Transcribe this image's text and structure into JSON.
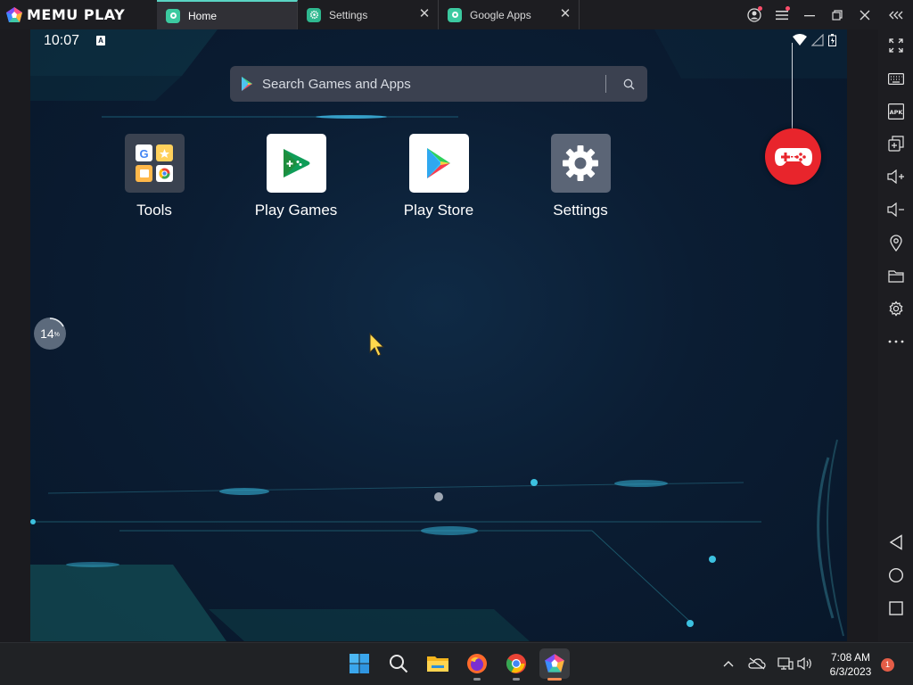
{
  "app": {
    "name": "MEMU PLAY"
  },
  "tabs": [
    {
      "label": "Home",
      "active": true
    },
    {
      "label": "Settings",
      "active": false
    },
    {
      "label": "Google Apps",
      "active": false
    }
  ],
  "android": {
    "status": {
      "time": "10:07",
      "badge": "A"
    },
    "search": {
      "placeholder": "Search Games and Apps"
    },
    "apps": [
      {
        "label": "Tools",
        "icon": "tools-folder-icon"
      },
      {
        "label": "Play Games",
        "icon": "play-games-icon"
      },
      {
        "label": "Play Store",
        "icon": "play-store-icon"
      },
      {
        "label": "Settings",
        "icon": "settings-gear-icon"
      }
    ],
    "cpu": {
      "value": "14",
      "unit": "%"
    }
  },
  "sidebar": {
    "items": [
      "fullscreen-icon",
      "keyboard-icon",
      "apk-icon",
      "multi-instance-icon",
      "volume-up-icon",
      "volume-down-icon",
      "location-icon",
      "folder-icon",
      "settings-icon",
      "more-icon",
      "back-icon",
      "home-icon",
      "recents-icon"
    ],
    "apk_label": "APK"
  },
  "taskbar": {
    "time": "7:08 AM",
    "date": "6/3/2023",
    "notifications": "1"
  },
  "colors": {
    "accent": "#5ad4c4",
    "gamepad": "#e8252c",
    "titlebar": "#1d1d21"
  }
}
